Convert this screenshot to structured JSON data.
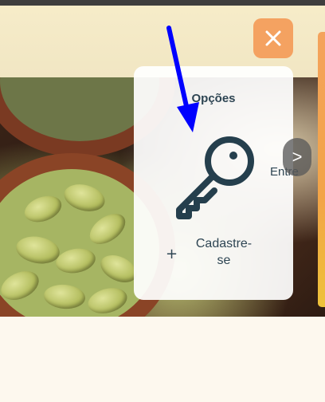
{
  "menu": {
    "title": "Opções",
    "login_icon": "key-icon",
    "login_label": "Entre",
    "signup_icon": "plus-icon",
    "signup_plus": "+",
    "signup_label": "Cadastre-se",
    "close_icon": "close-icon"
  },
  "carousel": {
    "next_label": ">"
  },
  "annotation": {
    "arrow_icon": "arrow-down-icon",
    "arrow_color": "#0000ff"
  },
  "colors": {
    "accent": "#f4a261",
    "text": "#2e4553",
    "header_bg": "#f3e8c6",
    "page_bg": "#fdf8ee"
  }
}
